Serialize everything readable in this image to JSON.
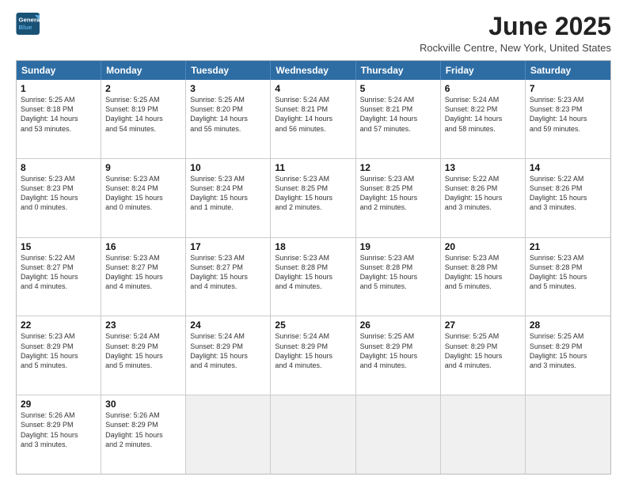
{
  "logo": {
    "line1": "General",
    "line2": "Blue"
  },
  "title": "June 2025",
  "location": "Rockville Centre, New York, United States",
  "weekdays": [
    "Sunday",
    "Monday",
    "Tuesday",
    "Wednesday",
    "Thursday",
    "Friday",
    "Saturday"
  ],
  "rows": [
    [
      {
        "day": "1",
        "lines": [
          "Sunrise: 5:25 AM",
          "Sunset: 8:18 PM",
          "Daylight: 14 hours",
          "and 53 minutes."
        ]
      },
      {
        "day": "2",
        "lines": [
          "Sunrise: 5:25 AM",
          "Sunset: 8:19 PM",
          "Daylight: 14 hours",
          "and 54 minutes."
        ]
      },
      {
        "day": "3",
        "lines": [
          "Sunrise: 5:25 AM",
          "Sunset: 8:20 PM",
          "Daylight: 14 hours",
          "and 55 minutes."
        ]
      },
      {
        "day": "4",
        "lines": [
          "Sunrise: 5:24 AM",
          "Sunset: 8:21 PM",
          "Daylight: 14 hours",
          "and 56 minutes."
        ]
      },
      {
        "day": "5",
        "lines": [
          "Sunrise: 5:24 AM",
          "Sunset: 8:21 PM",
          "Daylight: 14 hours",
          "and 57 minutes."
        ]
      },
      {
        "day": "6",
        "lines": [
          "Sunrise: 5:24 AM",
          "Sunset: 8:22 PM",
          "Daylight: 14 hours",
          "and 58 minutes."
        ]
      },
      {
        "day": "7",
        "lines": [
          "Sunrise: 5:23 AM",
          "Sunset: 8:23 PM",
          "Daylight: 14 hours",
          "and 59 minutes."
        ]
      }
    ],
    [
      {
        "day": "8",
        "lines": [
          "Sunrise: 5:23 AM",
          "Sunset: 8:23 PM",
          "Daylight: 15 hours",
          "and 0 minutes."
        ]
      },
      {
        "day": "9",
        "lines": [
          "Sunrise: 5:23 AM",
          "Sunset: 8:24 PM",
          "Daylight: 15 hours",
          "and 0 minutes."
        ]
      },
      {
        "day": "10",
        "lines": [
          "Sunrise: 5:23 AM",
          "Sunset: 8:24 PM",
          "Daylight: 15 hours",
          "and 1 minute."
        ]
      },
      {
        "day": "11",
        "lines": [
          "Sunrise: 5:23 AM",
          "Sunset: 8:25 PM",
          "Daylight: 15 hours",
          "and 2 minutes."
        ]
      },
      {
        "day": "12",
        "lines": [
          "Sunrise: 5:23 AM",
          "Sunset: 8:25 PM",
          "Daylight: 15 hours",
          "and 2 minutes."
        ]
      },
      {
        "day": "13",
        "lines": [
          "Sunrise: 5:22 AM",
          "Sunset: 8:26 PM",
          "Daylight: 15 hours",
          "and 3 minutes."
        ]
      },
      {
        "day": "14",
        "lines": [
          "Sunrise: 5:22 AM",
          "Sunset: 8:26 PM",
          "Daylight: 15 hours",
          "and 3 minutes."
        ]
      }
    ],
    [
      {
        "day": "15",
        "lines": [
          "Sunrise: 5:22 AM",
          "Sunset: 8:27 PM",
          "Daylight: 15 hours",
          "and 4 minutes."
        ]
      },
      {
        "day": "16",
        "lines": [
          "Sunrise: 5:23 AM",
          "Sunset: 8:27 PM",
          "Daylight: 15 hours",
          "and 4 minutes."
        ]
      },
      {
        "day": "17",
        "lines": [
          "Sunrise: 5:23 AM",
          "Sunset: 8:27 PM",
          "Daylight: 15 hours",
          "and 4 minutes."
        ]
      },
      {
        "day": "18",
        "lines": [
          "Sunrise: 5:23 AM",
          "Sunset: 8:28 PM",
          "Daylight: 15 hours",
          "and 4 minutes."
        ]
      },
      {
        "day": "19",
        "lines": [
          "Sunrise: 5:23 AM",
          "Sunset: 8:28 PM",
          "Daylight: 15 hours",
          "and 5 minutes."
        ]
      },
      {
        "day": "20",
        "lines": [
          "Sunrise: 5:23 AM",
          "Sunset: 8:28 PM",
          "Daylight: 15 hours",
          "and 5 minutes."
        ]
      },
      {
        "day": "21",
        "lines": [
          "Sunrise: 5:23 AM",
          "Sunset: 8:28 PM",
          "Daylight: 15 hours",
          "and 5 minutes."
        ]
      }
    ],
    [
      {
        "day": "22",
        "lines": [
          "Sunrise: 5:23 AM",
          "Sunset: 8:29 PM",
          "Daylight: 15 hours",
          "and 5 minutes."
        ]
      },
      {
        "day": "23",
        "lines": [
          "Sunrise: 5:24 AM",
          "Sunset: 8:29 PM",
          "Daylight: 15 hours",
          "and 5 minutes."
        ]
      },
      {
        "day": "24",
        "lines": [
          "Sunrise: 5:24 AM",
          "Sunset: 8:29 PM",
          "Daylight: 15 hours",
          "and 4 minutes."
        ]
      },
      {
        "day": "25",
        "lines": [
          "Sunrise: 5:24 AM",
          "Sunset: 8:29 PM",
          "Daylight: 15 hours",
          "and 4 minutes."
        ]
      },
      {
        "day": "26",
        "lines": [
          "Sunrise: 5:25 AM",
          "Sunset: 8:29 PM",
          "Daylight: 15 hours",
          "and 4 minutes."
        ]
      },
      {
        "day": "27",
        "lines": [
          "Sunrise: 5:25 AM",
          "Sunset: 8:29 PM",
          "Daylight: 15 hours",
          "and 4 minutes."
        ]
      },
      {
        "day": "28",
        "lines": [
          "Sunrise: 5:25 AM",
          "Sunset: 8:29 PM",
          "Daylight: 15 hours",
          "and 3 minutes."
        ]
      }
    ],
    [
      {
        "day": "29",
        "lines": [
          "Sunrise: 5:26 AM",
          "Sunset: 8:29 PM",
          "Daylight: 15 hours",
          "and 3 minutes."
        ]
      },
      {
        "day": "30",
        "lines": [
          "Sunrise: 5:26 AM",
          "Sunset: 8:29 PM",
          "Daylight: 15 hours",
          "and 2 minutes."
        ]
      },
      {
        "day": "",
        "lines": []
      },
      {
        "day": "",
        "lines": []
      },
      {
        "day": "",
        "lines": []
      },
      {
        "day": "",
        "lines": []
      },
      {
        "day": "",
        "lines": []
      }
    ]
  ]
}
